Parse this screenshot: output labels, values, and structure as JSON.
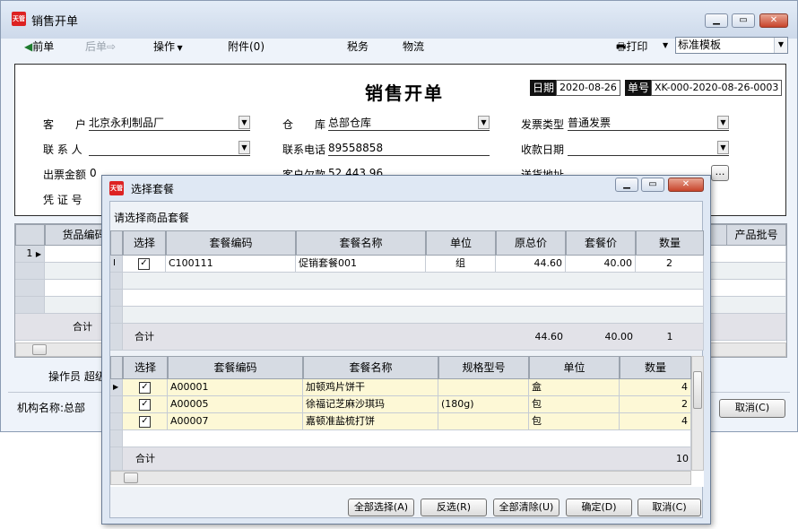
{
  "window": {
    "title": "销售开单"
  },
  "toolbar": {
    "prev": "前单",
    "next": "后单",
    "ops": "操作",
    "attach": "附件(0)",
    "tax": "税务",
    "logistics": "物流",
    "print": "打印",
    "template": "标准模板"
  },
  "form": {
    "title": "销售开单",
    "date_label": "日期",
    "date_value": "2020-08-26",
    "no_label": "单号",
    "no_value": "XK-000-2020-08-26-0003",
    "customer_label": "客　　户",
    "customer_value": "北京永利制品厂",
    "warehouse_label": "仓　　库",
    "warehouse_value": "总部仓库",
    "invoice_type_label": "发票类型",
    "invoice_type_value": "普通发票",
    "contact_label": "联 系 人",
    "contact_value": "",
    "phone_label": "联系电话",
    "phone_value": "89558858",
    "receive_date_label": "收款日期",
    "receive_date_value": "",
    "invoice_amount_label": "出票金额",
    "invoice_amount_value": "0",
    "customer_debt_label": "客户欠款",
    "customer_debt_value": "52,443.96",
    "ship_addr_label": "送货地址",
    "voucher_label": "凭 证 号"
  },
  "main_grid": {
    "col_code": "货品编码",
    "col_batch": "产品批号",
    "row1": "1",
    "total": "合计"
  },
  "footer": {
    "operator_label": "操作员",
    "operator_value": "超级",
    "org_label": "机构名称:",
    "org_value": "总部",
    "cancel": "取消(C)"
  },
  "dialog": {
    "title": "选择套餐",
    "prompt": "请选择商品套餐",
    "top_headers": [
      "选择",
      "套餐编码",
      "套餐名称",
      "单位",
      "原总价",
      "套餐价",
      "数量"
    ],
    "top_rows": [
      {
        "checked": true,
        "code": "C100111",
        "name": "促销套餐001",
        "unit": "组",
        "orig": "44.60",
        "price": "40.00",
        "qty": "2"
      }
    ],
    "top_total": {
      "label": "合计",
      "orig": "44.60",
      "price": "40.00",
      "qty": "1"
    },
    "bottom_headers": [
      "选择",
      "套餐编码",
      "套餐名称",
      "规格型号",
      "单位",
      "数量"
    ],
    "bottom_rows": [
      {
        "checked": true,
        "code": "A00001",
        "name": "加顿鸡片饼干",
        "spec": "",
        "unit": "盒",
        "qty": "4"
      },
      {
        "checked": true,
        "code": "A00005",
        "name": "徐福记芝麻沙琪玛",
        "spec": "(180g)",
        "unit": "包",
        "qty": "2"
      },
      {
        "checked": true,
        "code": "A00007",
        "name": "嘉顿准盐梳打饼",
        "spec": "",
        "unit": "包",
        "qty": "4"
      }
    ],
    "bottom_total": {
      "label": "合计",
      "qty": "10"
    },
    "buttons": {
      "select_all": "全部选择(A)",
      "invert": "反选(R)",
      "clear_all": "全部清除(U)",
      "ok": "确定(D)",
      "cancel": "取消(C)"
    }
  },
  "colors": {
    "selected_row": "#fdf8d6",
    "header_bg": "#d6dbe3",
    "title_bar": "#cdd9ea"
  }
}
